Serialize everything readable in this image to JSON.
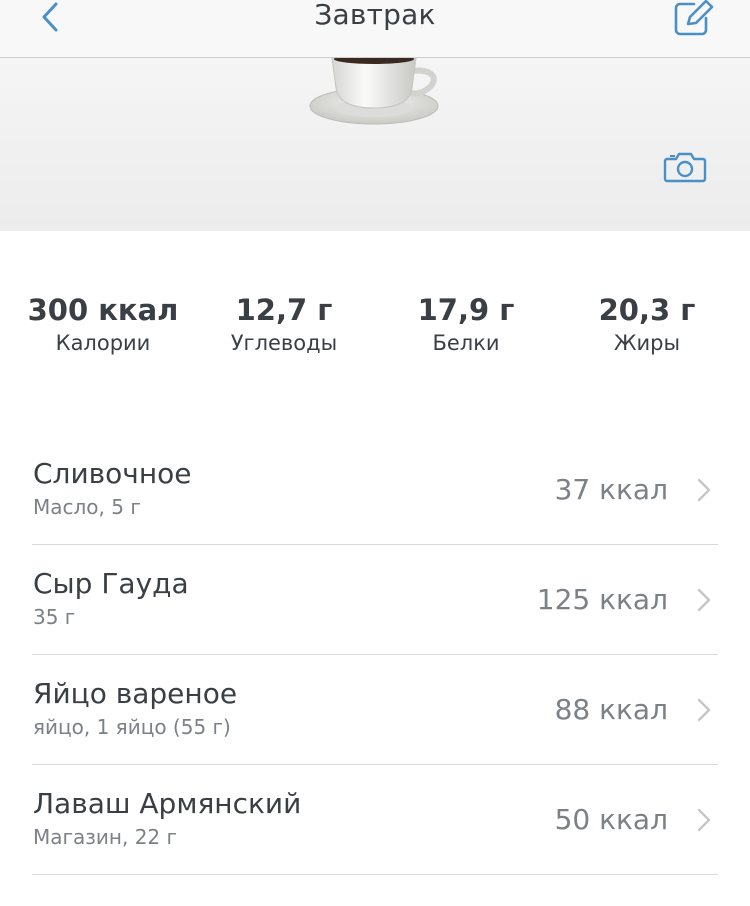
{
  "header": {
    "title": "Завтрак",
    "back_icon": "chevron-left-icon",
    "edit_icon": "edit-icon",
    "accent_color": "#4a90c8"
  },
  "hero": {
    "image": "coffee-cup",
    "camera_icon": "camera-icon"
  },
  "summary": [
    {
      "value": "300 ккал",
      "label": "Калории"
    },
    {
      "value": "12,7 г",
      "label": "Углеводы"
    },
    {
      "value": "17,9 г",
      "label": "Белки"
    },
    {
      "value": "20,3 г",
      "label": "Жиры"
    }
  ],
  "items": [
    {
      "name": "Сливочное",
      "detail": "Масло, 5 г",
      "kcal": "37 ккал"
    },
    {
      "name": "Сыр Гауда",
      "detail": "35 г",
      "kcal": "125 ккал"
    },
    {
      "name": "Яйцо вареное",
      "detail": "яйцо, 1 яйцо (55 г)",
      "kcal": "88 ккал"
    },
    {
      "name": "Лаваш Армянский",
      "detail": "Магазин, 22 г",
      "kcal": "50 ккал"
    }
  ]
}
